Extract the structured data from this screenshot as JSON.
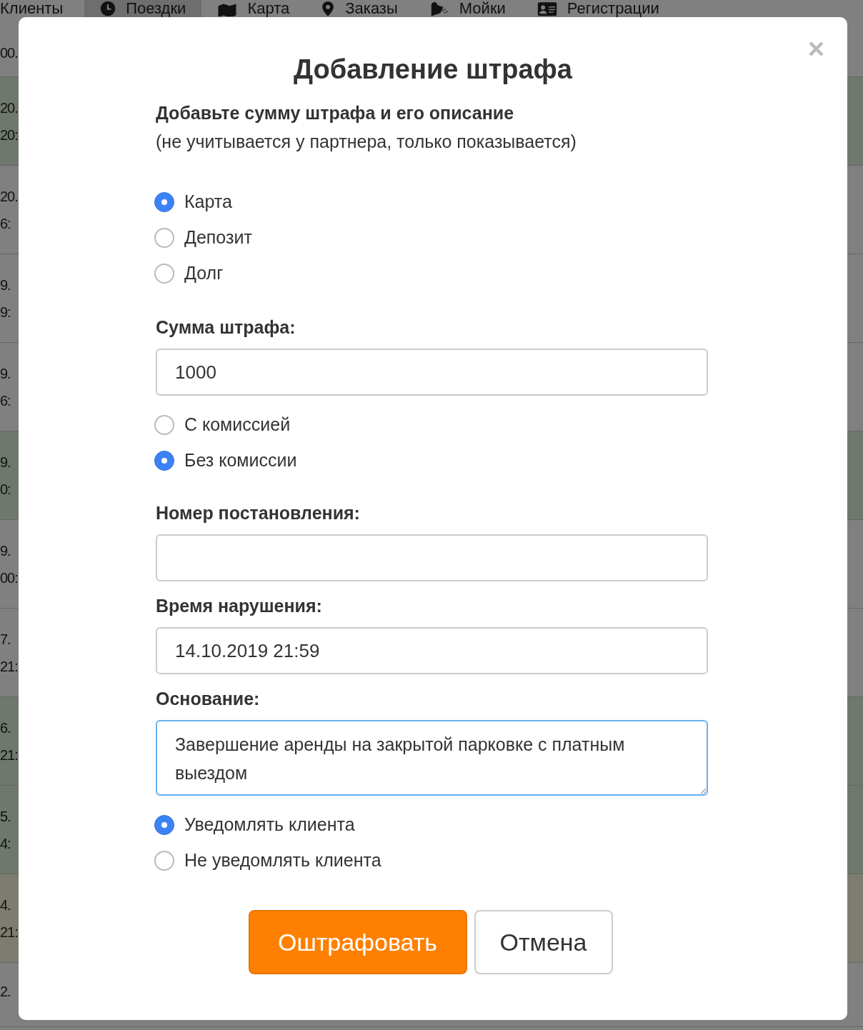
{
  "nav": [
    {
      "label": "Клиенты",
      "selected": false
    },
    {
      "label": "Поездки",
      "selected": true
    },
    {
      "label": "Карта",
      "selected": false
    },
    {
      "label": "Заказы",
      "selected": false
    },
    {
      "label": "Мойки",
      "selected": false
    },
    {
      "label": "Регистрации",
      "selected": false
    }
  ],
  "background_rows": [
    {
      "lines": [
        "00."
      ]
    },
    {
      "color": "#6f786c",
      "lines": [
        "20.",
        "20:"
      ]
    },
    {
      "color": "#808080",
      "lines": [
        "20.",
        "6:"
      ]
    },
    {
      "color": "#808080",
      "lines": [
        "9.",
        "9:"
      ]
    },
    {
      "color": "#808080",
      "lines": [
        "9.",
        "6:"
      ]
    },
    {
      "color": "#6f786c",
      "lines": [
        "9.",
        "0:"
      ]
    },
    {
      "color": "#808080",
      "lines": [
        "9.",
        "00:"
      ]
    },
    {
      "color": "#808080",
      "lines": [
        "7.",
        "21:"
      ]
    },
    {
      "color": "#6f786c",
      "lines": [
        "6.",
        "21:"
      ]
    },
    {
      "color": "#6f786c",
      "lines": [
        "5.",
        "4:"
      ]
    },
    {
      "color": "#7e7c71",
      "lines": [
        "4.",
        "21:"
      ]
    },
    {
      "lines": [
        "2."
      ]
    }
  ],
  "dialog": {
    "title": "Добавление штрафа",
    "close": "×",
    "heading": "Добавьте сумму штрафа и его описание",
    "note": "(не учитывается у партнера, только показывается)",
    "payment_source": [
      {
        "label": "Карта",
        "selected": true
      },
      {
        "label": "Депозит",
        "selected": false
      },
      {
        "label": "Долг",
        "selected": false
      }
    ],
    "amount": {
      "label": "Сумма штрафа:",
      "value": "1000"
    },
    "commission": [
      {
        "label": "С комиссией",
        "selected": false
      },
      {
        "label": "Без комиссии",
        "selected": true
      }
    ],
    "decree_number": {
      "label": "Номер постановления:"
    },
    "violation_time": {
      "label": "Время нарушения:",
      "value": "14.10.2019 21:59"
    },
    "basis": {
      "label": "Основание:",
      "value": "Завершение аренды на закрытой парковке с платным выездом"
    },
    "notify": [
      {
        "label": "Уведомлять клиента",
        "selected": true
      },
      {
        "label": "Не уведомлять клиента",
        "selected": false
      }
    ],
    "buttons": [
      {
        "label": "Оштрафовать",
        "kind": "primary"
      },
      {
        "label": "Отмена",
        "kind": "secondary"
      }
    ]
  }
}
